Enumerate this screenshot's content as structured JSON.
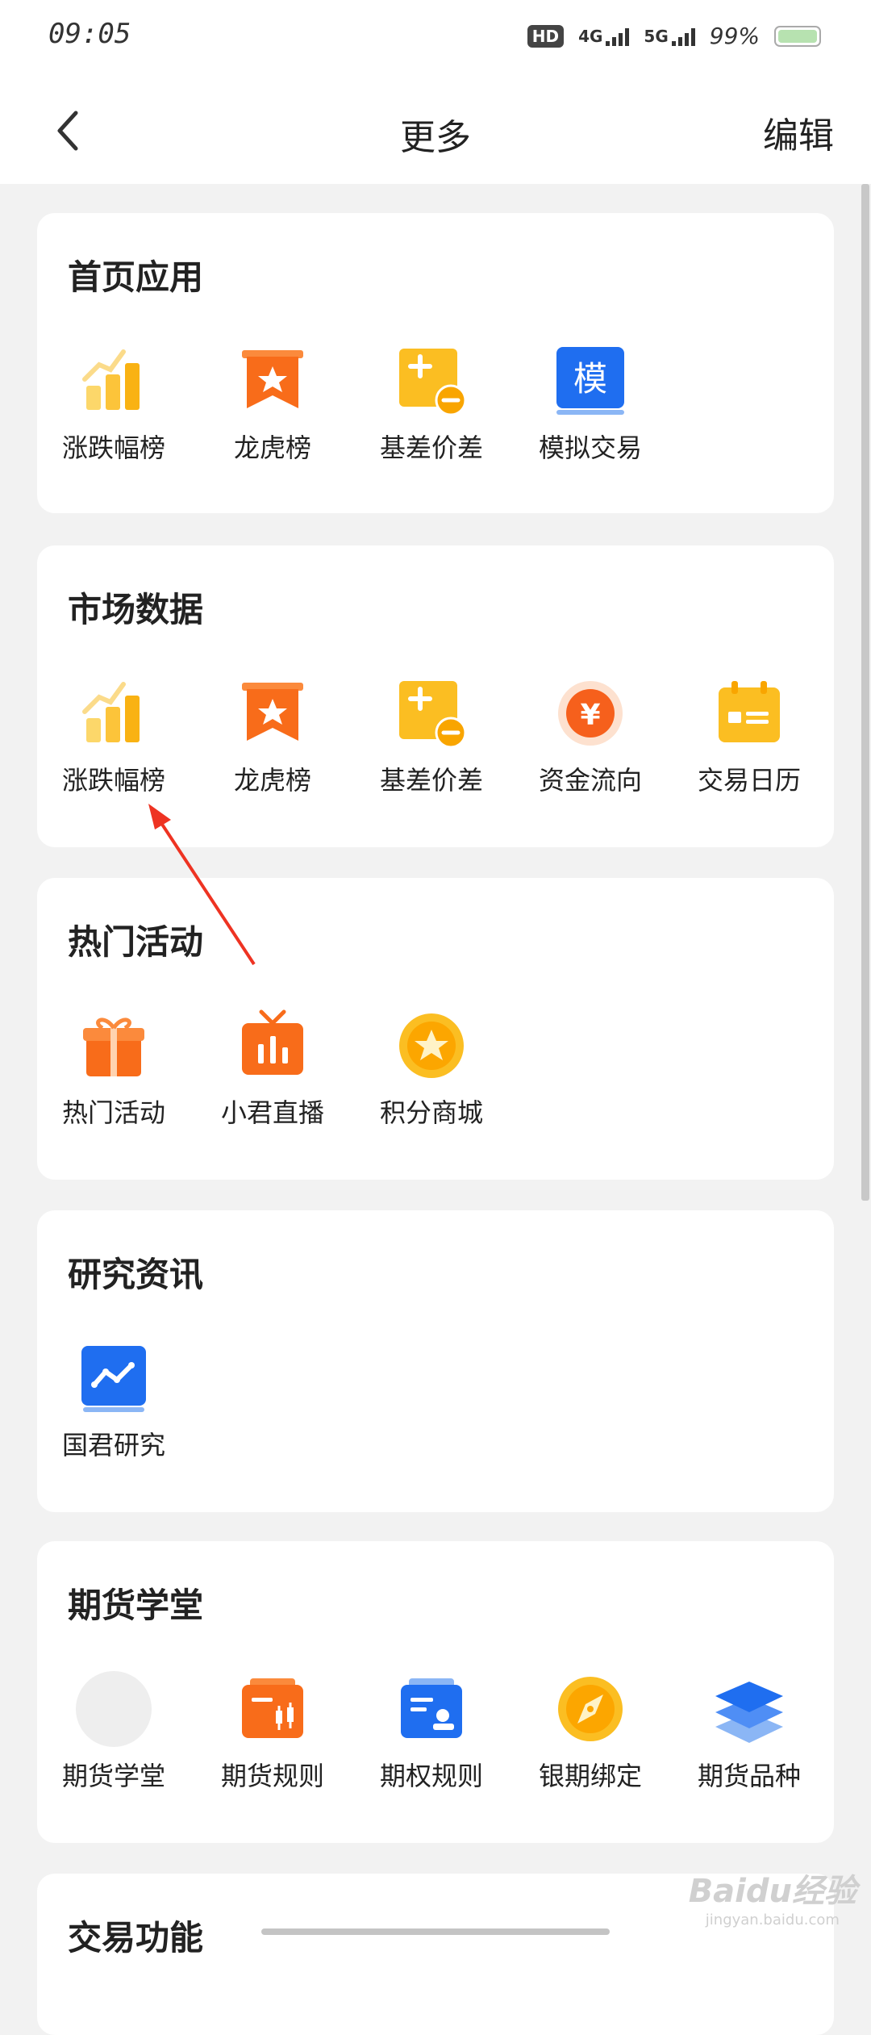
{
  "status_bar": {
    "time": "09:05",
    "hd": "HD",
    "net1": "4G",
    "net2": "5G",
    "battery": "99%"
  },
  "nav": {
    "title": "更多",
    "edit_label": "编辑"
  },
  "sections": [
    {
      "title": "首页应用",
      "items": [
        {
          "label": "涨跌幅榜",
          "icon": "bar-chart-icon"
        },
        {
          "label": "龙虎榜",
          "icon": "star-banner-icon"
        },
        {
          "label": "基差价差",
          "icon": "plus-minus-icon"
        },
        {
          "label": "模拟交易",
          "icon": "mo-badge-icon",
          "glyph": "模"
        }
      ]
    },
    {
      "title": "市场数据",
      "items": [
        {
          "label": "涨跌幅榜",
          "icon": "bar-chart-icon"
        },
        {
          "label": "龙虎榜",
          "icon": "star-banner-icon"
        },
        {
          "label": "基差价差",
          "icon": "plus-minus-icon"
        },
        {
          "label": "资金流向",
          "icon": "yuan-coin-icon",
          "glyph": "¥"
        },
        {
          "label": "交易日历",
          "icon": "calendar-icon"
        }
      ]
    },
    {
      "title": "热门活动",
      "items": [
        {
          "label": "热门活动",
          "icon": "gift-icon"
        },
        {
          "label": "小君直播",
          "icon": "live-tv-icon"
        },
        {
          "label": "积分商城",
          "icon": "star-coin-icon"
        }
      ]
    },
    {
      "title": "研究资讯",
      "items": [
        {
          "label": "国君研究",
          "icon": "trend-line-icon"
        }
      ]
    },
    {
      "title": "期货学堂",
      "items": [
        {
          "label": "期货学堂",
          "icon": "placeholder-icon"
        },
        {
          "label": "期货规则",
          "icon": "candlestick-icon"
        },
        {
          "label": "期权规则",
          "icon": "id-card-icon"
        },
        {
          "label": "银期绑定",
          "icon": "compass-icon"
        },
        {
          "label": "期货品种",
          "icon": "layers-icon"
        }
      ]
    },
    {
      "title": "交易功能",
      "items": []
    }
  ],
  "watermark": {
    "text": "Baidu经验",
    "sub": "jingyan.baidu.com"
  }
}
